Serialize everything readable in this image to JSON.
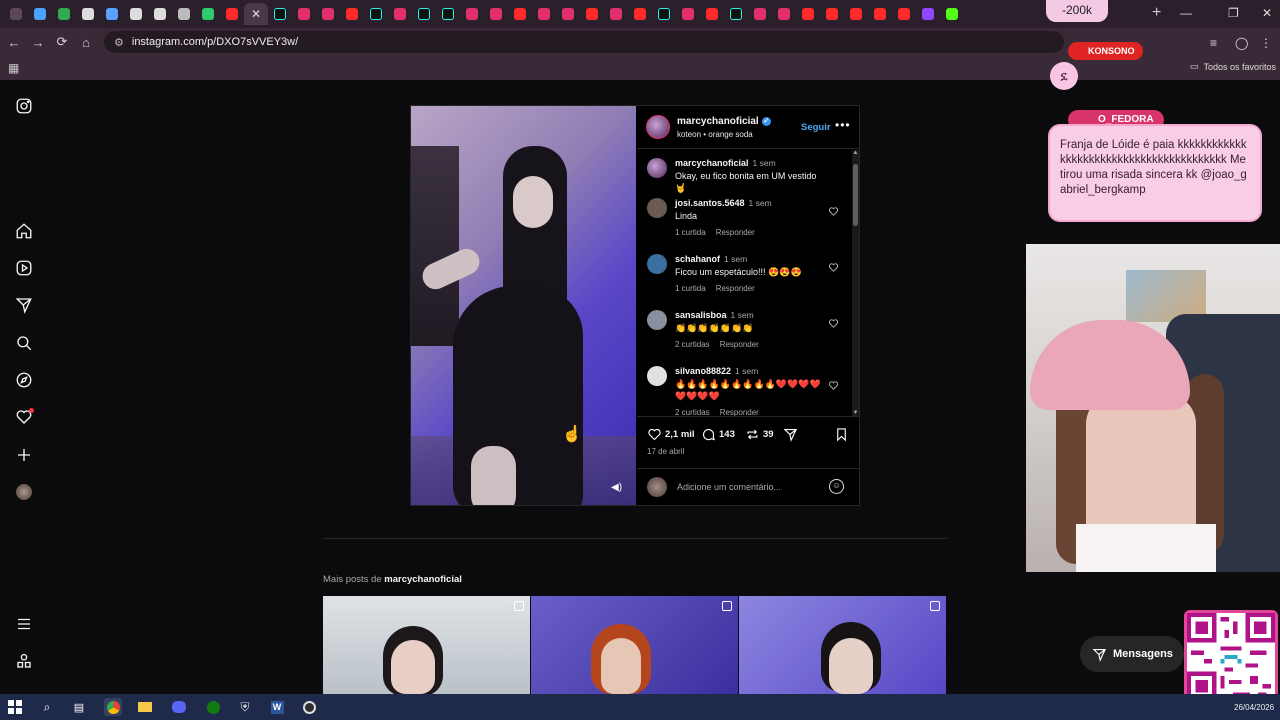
{
  "browser": {
    "url": "instagram.com/p/DXO7sVVEY3w/",
    "favorites_label": "Todos os favoritos",
    "tab_favicons": [
      {
        "icon": "tab-menu-icon",
        "color": "#5a4858"
      },
      {
        "icon": "gem-icon",
        "color": "#4aa3ff"
      },
      {
        "icon": "drive-icon",
        "color": "#34a853"
      },
      {
        "icon": "s-icon",
        "color": "#dddddd"
      },
      {
        "icon": "cloud-icon",
        "color": "#5aa2ff"
      },
      {
        "icon": "github-icon",
        "color": "#dddddd"
      },
      {
        "icon": "anchor-icon",
        "color": "#dddddd"
      },
      {
        "icon": "globe-icon",
        "color": "#bbbbbb"
      },
      {
        "icon": "code-icon",
        "color": "#2ecc71"
      },
      {
        "icon": "youtube-icon",
        "color": "#ff2a2a"
      },
      {
        "icon": "close-icon",
        "color": "#dddddd"
      },
      {
        "icon": "tiktok-icon",
        "color": "#111111"
      },
      {
        "icon": "instagram-icon",
        "color": "#e1306c"
      },
      {
        "icon": "instagram-icon",
        "color": "#e1306c"
      },
      {
        "icon": "youtube-icon",
        "color": "#ff2a2a"
      },
      {
        "icon": "tiktok-icon",
        "color": "#111111"
      },
      {
        "icon": "instagram-icon",
        "color": "#e1306c"
      },
      {
        "icon": "tiktok-icon",
        "color": "#111111"
      },
      {
        "icon": "tiktok-icon",
        "color": "#111111"
      },
      {
        "icon": "instagram-icon",
        "color": "#e1306c"
      },
      {
        "icon": "instagram-icon",
        "color": "#e1306c"
      },
      {
        "icon": "youtube-icon",
        "color": "#ff2a2a"
      },
      {
        "icon": "instagram-icon",
        "color": "#e1306c"
      },
      {
        "icon": "instagram-icon",
        "color": "#e1306c"
      },
      {
        "icon": "youtube-icon",
        "color": "#ff2a2a"
      },
      {
        "icon": "instagram-icon",
        "color": "#e1306c"
      },
      {
        "icon": "youtube-icon",
        "color": "#ff2a2a"
      },
      {
        "icon": "tiktok-icon",
        "color": "#111111"
      },
      {
        "icon": "instagram-icon",
        "color": "#e1306c"
      },
      {
        "icon": "youtube-icon",
        "color": "#ff2a2a"
      },
      {
        "icon": "tiktok-icon",
        "color": "#111111"
      },
      {
        "icon": "instagram-icon",
        "color": "#e1306c"
      },
      {
        "icon": "instagram-icon",
        "color": "#e1306c"
      },
      {
        "icon": "youtube-icon",
        "color": "#ff2a2a"
      },
      {
        "icon": "youtube-icon",
        "color": "#ff2a2a"
      },
      {
        "icon": "youtube-icon",
        "color": "#ff2a2a"
      },
      {
        "icon": "youtube-icon",
        "color": "#ff2a2a"
      },
      {
        "icon": "youtube-icon",
        "color": "#ff2a2a"
      },
      {
        "icon": "twitch-icon",
        "color": "#9146ff"
      },
      {
        "icon": "kick-icon",
        "color": "#53fc18"
      }
    ]
  },
  "post": {
    "username": "marcychanoficial",
    "audio": "koteon • orange soda",
    "follow_label": "Seguir",
    "caption": {
      "user": "marcychanoficial",
      "time": "1 sem",
      "text": "Okay, eu fico bonita em UM vestido 🤘"
    },
    "comments": [
      {
        "user": "josi.santos.5648",
        "time": "1 sem",
        "text": "Linda",
        "likes": "1 curtida",
        "reply": "Responder",
        "avatar": "#6b5a50"
      },
      {
        "user": "schahanof",
        "time": "1 sem",
        "text": "Ficou um espetáculo!!! 😍😍😍",
        "likes": "1 curtida",
        "reply": "Responder",
        "avatar": "#3a6fa0"
      },
      {
        "user": "sansalisboa",
        "time": "1 sem",
        "text": "👏👏👏👏👏👏👏",
        "likes": "2 curtidas",
        "reply": "Responder",
        "avatar": "#8a8fa0"
      },
      {
        "user": "silvano88822",
        "time": "1 sem",
        "text": "🔥🔥🔥🔥🔥🔥🔥🔥🔥❤️❤️❤️❤️❤️❤️❤️❤️",
        "likes": "2 curtidas",
        "reply": "Responder",
        "avatar": "#e0e0e0"
      }
    ],
    "likes": "2,1 mil",
    "comments_count": "143",
    "reposts": "39",
    "date": "17 de abril",
    "add_comment_placeholder": "Adicione um comentário..."
  },
  "more_posts": {
    "prefix": "Mais posts de",
    "user": "marcychanoficial"
  },
  "messages_label": "Mensagens",
  "overlays": {
    "amount": "-200k",
    "konsono_tag": "KONSONO",
    "fedora_tag": "O_FEDORA",
    "chat_message": "Franja de Lóide é paia kkkkkkkkkkkkkkkkkkkkkkkkkkkkkkkkkkkkkkkkk Me tirou uma risada sincera kk @joao_gabriel_bergkamp"
  },
  "taskbar": {
    "date": "26/04/2026"
  }
}
